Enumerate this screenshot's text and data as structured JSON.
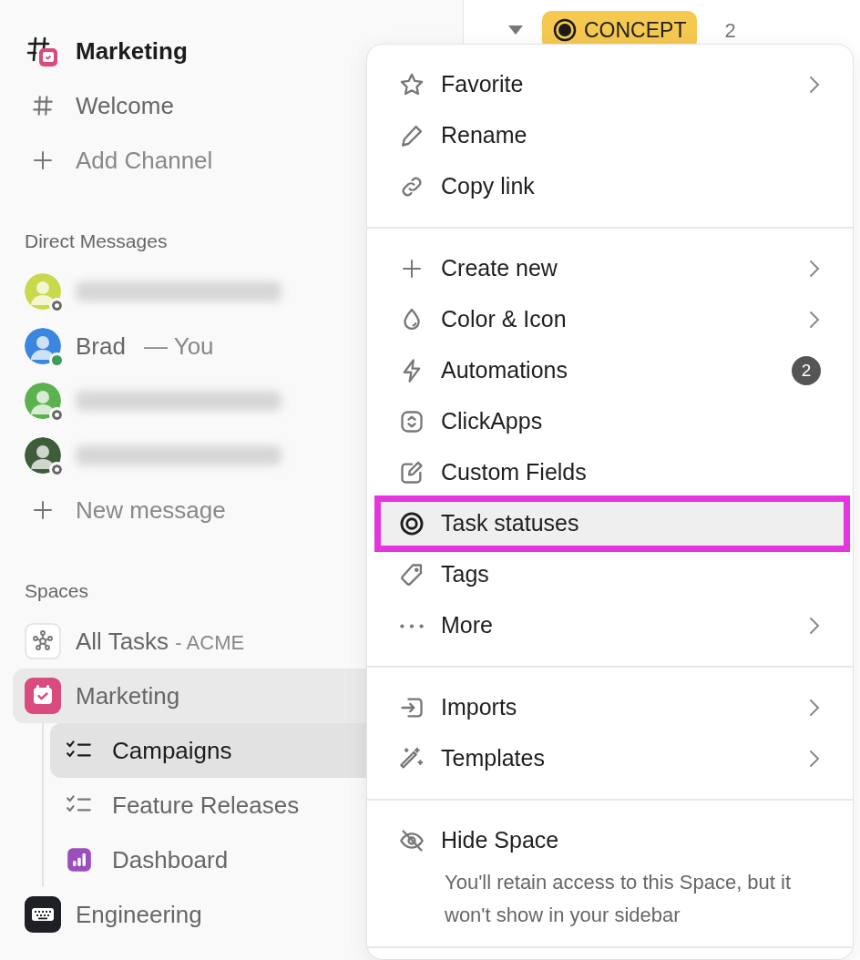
{
  "sidebar": {
    "channels": [
      {
        "label": "Marketing",
        "kind": "space-channel",
        "unread": true
      },
      {
        "label": "Welcome",
        "kind": "hash",
        "unread": false
      }
    ],
    "add_channel": "Add Channel",
    "direct_messages": {
      "title": "Direct Messages",
      "people": [
        {
          "redacted": true,
          "online": false,
          "color": "#c9d94b"
        },
        {
          "redacted": false,
          "name": "Brad",
          "suffix": "— You",
          "online": true,
          "color": "#3b86e0"
        },
        {
          "redacted": true,
          "online": false,
          "color": "#5cb24f"
        },
        {
          "redacted": true,
          "online": false,
          "color": "#3f5c3b"
        }
      ],
      "new_message": "New message"
    },
    "spaces": {
      "title": "Spaces",
      "items": [
        {
          "label": "All Tasks",
          "suffix": "- ACME",
          "kind": "all",
          "selected": false
        },
        {
          "label": "Marketing",
          "kind": "space",
          "color": "#d94b7e",
          "selected": true,
          "expanded": true,
          "children": [
            {
              "label": "Campaigns",
              "kind": "list",
              "selected": true
            },
            {
              "label": "Feature Releases",
              "kind": "list",
              "selected": false
            },
            {
              "label": "Dashboard",
              "kind": "dashboard",
              "selected": false
            }
          ]
        },
        {
          "label": "Engineering",
          "kind": "space",
          "color": "#1f2026",
          "selected": false,
          "expanded": false
        }
      ]
    }
  },
  "main": {
    "group": {
      "status": "CONCEPT",
      "count": "2",
      "color": "#f5c84f",
      "expanded": true
    }
  },
  "context_menu": {
    "sections": [
      {
        "items": [
          {
            "label": "Favorite",
            "kind": "star",
            "submenu": true,
            "selected": false
          },
          {
            "label": "Rename",
            "kind": "pencil",
            "submenu": false,
            "selected": false
          },
          {
            "label": "Copy link",
            "kind": "link",
            "submenu": false,
            "selected": false
          }
        ]
      },
      {
        "items": [
          {
            "label": "Create new",
            "kind": "plus",
            "submenu": true,
            "selected": false
          },
          {
            "label": "Color & Icon",
            "kind": "drop",
            "submenu": true,
            "selected": false
          },
          {
            "label": "Automations",
            "kind": "bolt",
            "submenu": false,
            "badge": "2",
            "selected": false
          },
          {
            "label": "ClickApps",
            "kind": "apps",
            "submenu": false,
            "selected": false
          },
          {
            "label": "Custom Fields",
            "kind": "edit",
            "submenu": false,
            "selected": false
          },
          {
            "label": "Task statuses",
            "kind": "target",
            "submenu": false,
            "selected": true
          },
          {
            "label": "Tags",
            "kind": "tag",
            "submenu": false,
            "selected": false
          },
          {
            "label": "More",
            "kind": "dots",
            "submenu": true,
            "selected": false
          }
        ]
      },
      {
        "items": [
          {
            "label": "Imports",
            "kind": "import",
            "submenu": true,
            "selected": false
          },
          {
            "label": "Templates",
            "kind": "wand",
            "submenu": true,
            "selected": false
          }
        ]
      },
      {
        "items": [
          {
            "label": "Hide Space",
            "kind": "eye-off",
            "submenu": false,
            "selected": false,
            "description": "You'll retain access to this Space, but it won't show in your sidebar"
          }
        ]
      }
    ]
  }
}
